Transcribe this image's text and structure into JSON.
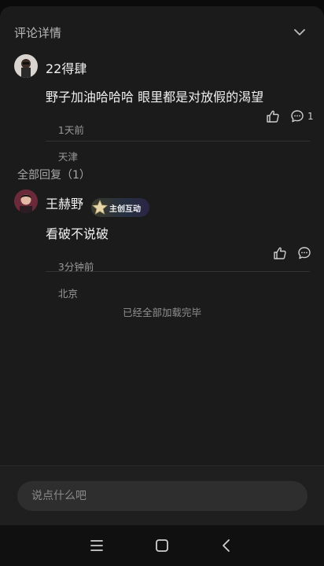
{
  "header": {
    "title": "评论详情",
    "collapse_icon": "chevron-down-icon"
  },
  "comment": {
    "username": "22得肆",
    "text": "野子加油哈哈哈 眼里都是对放假的渴望",
    "time": "1天前",
    "location": "天津",
    "reply_count": "1",
    "like_icon": "thumbs-up-icon",
    "reply_icon": "comment-icon"
  },
  "replies_section": {
    "title": "全部回复（1）"
  },
  "reply": {
    "username": "王赫野",
    "badge": "主创互动",
    "text": "看破不说破",
    "time": "3分钟前",
    "location": "北京",
    "like_icon": "thumbs-up-icon",
    "more_icon": "more-dots-icon"
  },
  "end_text": "已经全部加载完毕",
  "input": {
    "placeholder": "说点什么吧"
  },
  "navbar": {
    "menu_icon": "menu-icon",
    "home_icon": "home-square-icon",
    "back_icon": "back-chevron-icon"
  },
  "colors": {
    "panel_bg": "#1b1b1b",
    "page_bg": "#0b0b0b",
    "input_bg": "#2e2e2e",
    "secondary_text": "#9a9a9a"
  }
}
